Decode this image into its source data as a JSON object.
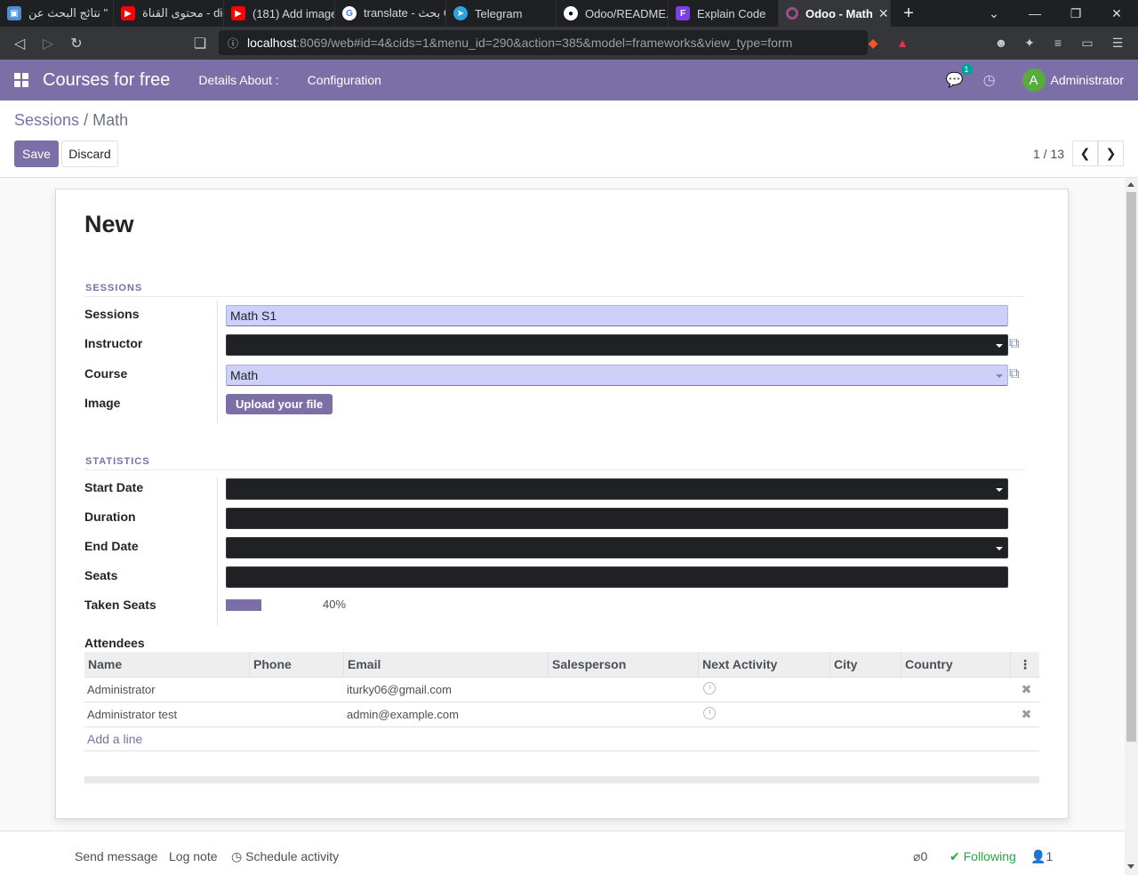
{
  "browser": {
    "tabs": [
      {
        "title": "نتائج البحث عن \"",
        "icon": "web-icon",
        "color": "#4a8fd1"
      },
      {
        "title": "محتوى القناة - dio",
        "icon": "youtube-icon",
        "color": "#ff0000"
      },
      {
        "title": "(181) Add image",
        "icon": "youtube-icon",
        "color": "#ff0000"
      },
      {
        "title": "translate - بحث G",
        "icon": "google-icon",
        "color": "#ffffff"
      },
      {
        "title": "Telegram",
        "icon": "telegram-icon",
        "color": "#2aa3de"
      },
      {
        "title": "Odoo/README.r",
        "icon": "github-icon",
        "color": "#ffffff"
      },
      {
        "title": "Explain Code",
        "icon": "code-icon",
        "color": "#7b3fe4"
      },
      {
        "title": "Odoo - Math",
        "icon": "odoo-icon",
        "color": "#9a4f87",
        "active": true
      }
    ],
    "url_host": "localhost",
    "url_rest": ":8069/web#id=4&cids=1&menu_id=290&action=385&model=frameworks&view_type=form"
  },
  "nav": {
    "app_name": "Courses for free",
    "menu": [
      "Details About :",
      "Configuration"
    ],
    "chat_badge": "1",
    "avatar_letter": "A",
    "user_name": "Administrator"
  },
  "control": {
    "breadcrumb_parent": "Sessions",
    "breadcrumb_sep": "/",
    "breadcrumb_current": "Math",
    "save_label": "Save",
    "discard_label": "Discard",
    "pager": "1 / 13"
  },
  "form": {
    "title": "New",
    "group1_title": "SESSIONS",
    "group2_title": "STATISTICS",
    "labels": {
      "sessions": "Sessions",
      "instructor": "Instructor",
      "course": "Course",
      "image": "Image",
      "start_date": "Start Date",
      "duration": "Duration",
      "end_date": "End Date",
      "seats": "Seats",
      "taken_seats": "Taken Seats"
    },
    "values": {
      "sessions": "Math S1",
      "instructor": "",
      "course": "Math",
      "start_date": "",
      "duration": "",
      "end_date": "",
      "seats": ""
    },
    "upload_label": "Upload your file",
    "taken_seats_percent": 40,
    "taken_seats_text": "40%"
  },
  "attendees": {
    "label": "Attendees",
    "columns": [
      "Name",
      "Phone",
      "Email",
      "Salesperson",
      "Next Activity",
      "City",
      "Country"
    ],
    "rows": [
      {
        "name": "Administrator",
        "phone": "",
        "email": "iturky06@gmail.com",
        "salesperson": "",
        "city": "",
        "country": ""
      },
      {
        "name": "Administrator test",
        "phone": "",
        "email": "admin@example.com",
        "salesperson": "",
        "city": "",
        "country": ""
      }
    ],
    "add_line": "Add a line"
  },
  "chatter": {
    "send_message": "Send message",
    "log_note": "Log note",
    "schedule_activity": "Schedule activity",
    "attachments": "0",
    "following": "Following",
    "followers": "1"
  },
  "colors": {
    "brand": "#7c6fa8",
    "filled_field": "#cfcffc",
    "dark_field": "#202124"
  }
}
